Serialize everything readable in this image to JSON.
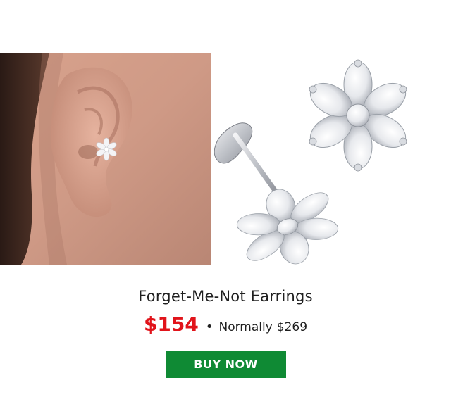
{
  "product": {
    "name": "Forget-Me-Not Earrings",
    "sale_price": "$154",
    "separator": "•",
    "normally_label": "Normally",
    "original_price": "$269"
  },
  "cta": {
    "label": "BUY NOW"
  },
  "colors": {
    "sale_price": "#e1141b",
    "button_bg": "#0f8a34",
    "text": "#1f1f1f"
  },
  "images": {
    "model_photo": "model-ear-wearing-earring",
    "product_photo": "flower-stud-earrings-pair"
  }
}
